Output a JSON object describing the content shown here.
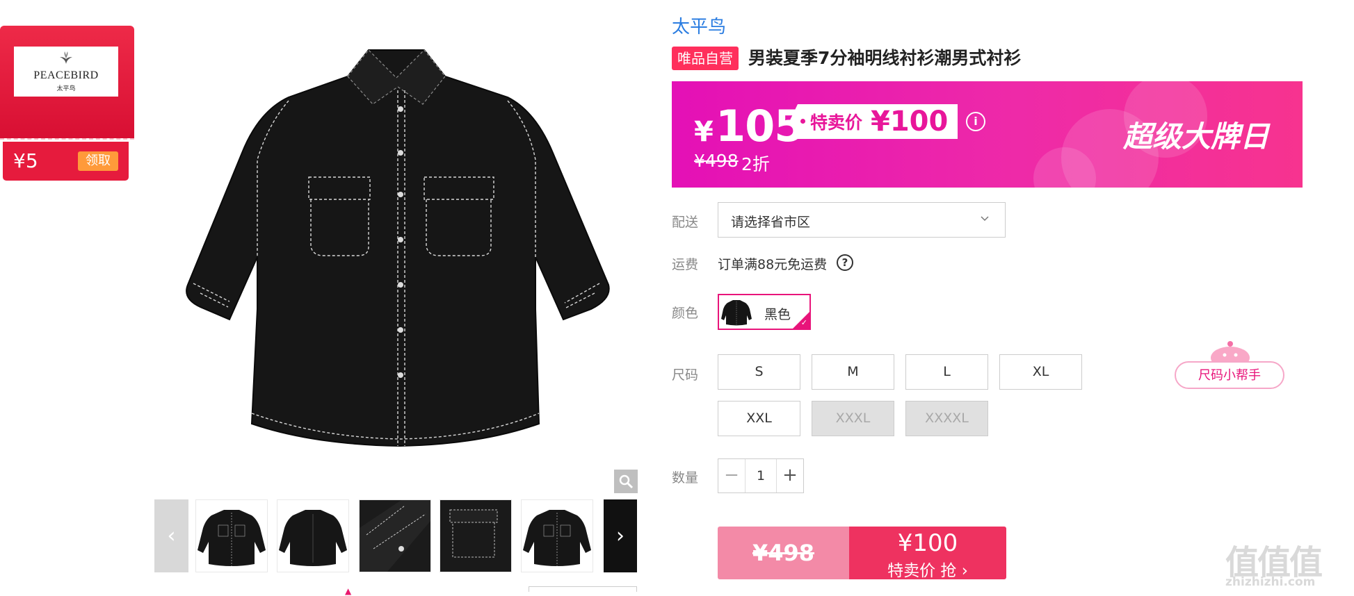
{
  "coupon": {
    "brand_en": "PEACEBIRD",
    "brand_cn": "太平鸟",
    "amount": "¥5",
    "claim_label": "领取"
  },
  "gallery": {
    "zoom_icon": "magnifier-icon",
    "prev_icon": "chevron-left-icon",
    "next_icon": "chevron-right-icon"
  },
  "product": {
    "brand": "太平鸟",
    "vip_tag": "唯品自营",
    "title": "男装夏季7分袖明线衬衫潮男式衬衫"
  },
  "price": {
    "currency": "¥",
    "price": "105",
    "special_label": "特卖价",
    "special_price": "¥100",
    "original": "¥498",
    "discount": "2折",
    "event": "超级大牌日",
    "info_icon": "info-icon"
  },
  "delivery": {
    "label": "配送",
    "placeholder": "请选择省市区"
  },
  "shipping": {
    "label": "运费",
    "text": "订单满88元免运费"
  },
  "color": {
    "label": "颜色",
    "selected": "黑色"
  },
  "size": {
    "label": "尺码",
    "options": [
      {
        "label": "S",
        "available": true
      },
      {
        "label": "M",
        "available": true
      },
      {
        "label": "L",
        "available": true
      },
      {
        "label": "XL",
        "available": true
      },
      {
        "label": "XXL",
        "available": true
      },
      {
        "label": "XXXL",
        "available": false
      },
      {
        "label": "XXXXL",
        "available": false
      }
    ],
    "helper": "尺码小帮手"
  },
  "quantity": {
    "label": "数量",
    "value": "1",
    "minus": "−",
    "plus": "+"
  },
  "buy": {
    "original": "¥498",
    "price": "¥100",
    "label": "特卖价 抢 ›"
  },
  "watermark": {
    "logo": "值值值",
    "url": "zhizhizhi.com"
  }
}
